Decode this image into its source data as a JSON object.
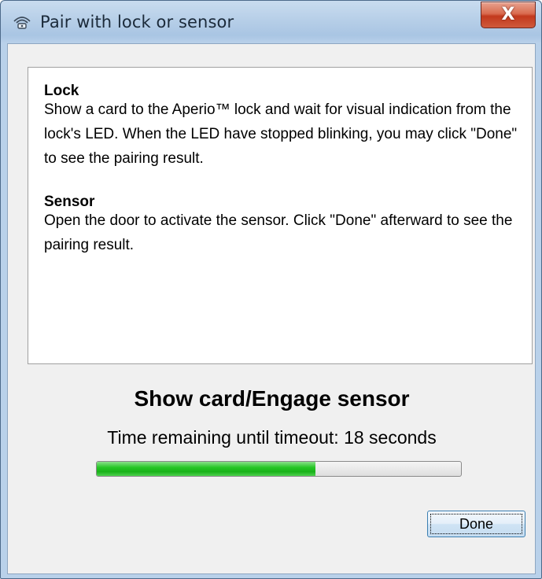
{
  "window": {
    "title": "Pair with lock or sensor",
    "close_label": "X"
  },
  "instructions": {
    "lock_title": "Lock",
    "lock_body": "Show a card to the Aperio™ lock and wait for visual indication from the lock's LED. When the LED have stopped blinking, you may click \"Done\" to see the pairing result.",
    "sensor_title": "Sensor",
    "sensor_body": "Open the door to activate the sensor. Click \"Done\" afterward to see the pairing result."
  },
  "status": {
    "title": "Show card/Engage sensor",
    "time_text": "Time remaining until timeout: 18 seconds",
    "progress_fraction": 0.6
  },
  "buttons": {
    "done_label": "Done"
  },
  "colors": {
    "progress_green": "#1fbf1f",
    "close_red": "#c7432a"
  },
  "icons": {
    "title_icon": "wireless-pair-icon",
    "close_icon": "close-icon"
  }
}
